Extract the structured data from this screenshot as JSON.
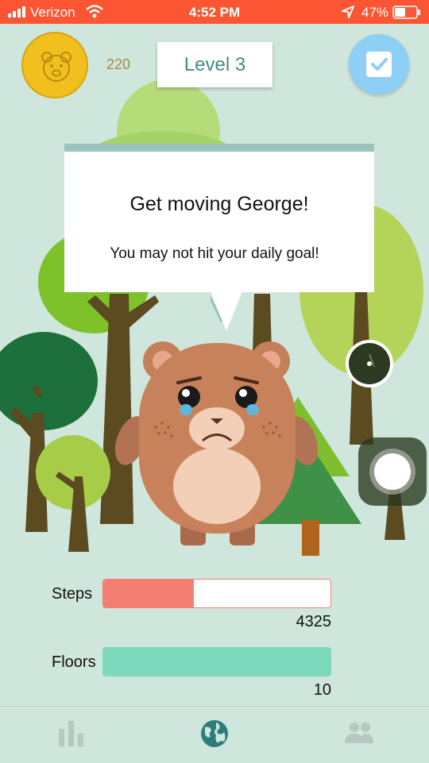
{
  "status_bar": {
    "carrier": "Verizon",
    "time": "4:52 PM",
    "battery": "47%"
  },
  "header": {
    "coins": "220",
    "level": "Level 3",
    "checklist_icon": "checkbox-icon"
  },
  "message": {
    "title": "Get moving George!",
    "body": "You may not hit your daily goal!"
  },
  "stats": {
    "steps": {
      "label": "Steps",
      "value": "4325",
      "progress": 0.4
    },
    "floors": {
      "label": "Floors",
      "value": "10",
      "progress": 1.0
    }
  },
  "tabs": [
    {
      "name": "stats",
      "icon": "bar-chart-icon",
      "active": false
    },
    {
      "name": "world",
      "icon": "globe-icon",
      "active": true
    },
    {
      "name": "friends",
      "icon": "people-icon",
      "active": false
    }
  ],
  "colors": {
    "status_bar": "#fb5534",
    "background": "#cfe6dc",
    "steps_bar": "#f27f72",
    "floors_bar": "#7dd9bc",
    "accent": "#3f8c83"
  }
}
